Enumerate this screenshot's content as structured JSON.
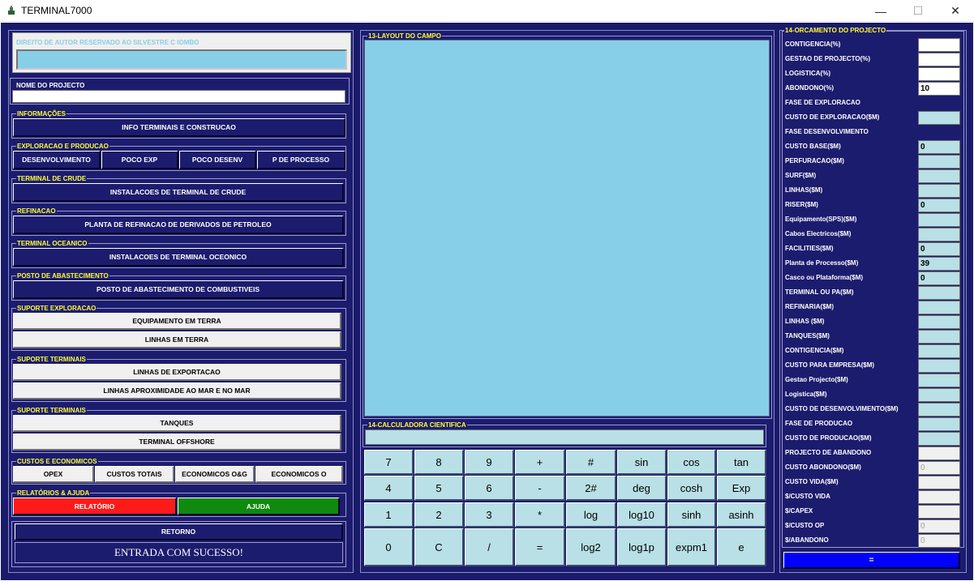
{
  "window": {
    "title": "TERMINAL7000",
    "minimize": "—",
    "maximize": "☐",
    "close": "✕"
  },
  "left": {
    "author": {
      "label": "DIREITO DE AUTOR RESERVADO AO SILVESTRE C IOMBO",
      "value": ""
    },
    "project_name": {
      "label": "NOME DO PROJECTO",
      "value": ""
    },
    "groups": {
      "info": {
        "label": "INFORMAÇÕES",
        "buttons": [
          "INFO TERMINAIS E CONSTRUCAO"
        ]
      },
      "explor": {
        "label": "EXPLORACAO E PRODUCAO",
        "buttons": [
          "DESENVOLVIMENTO",
          "POCO EXP",
          "POCO DESENV",
          "P DE PROCESSO"
        ]
      },
      "crude": {
        "label": "TERMINAL DE CRUDE",
        "buttons": [
          "INSTALACOES DE TERMINAL DE CRUDE"
        ]
      },
      "refin": {
        "label": "REFINACAO",
        "buttons": [
          "PLANTA DE REFINACAO DE DERIVADOS DE PETROLEO"
        ]
      },
      "ocean": {
        "label": "TERMINAL OCEANICO",
        "buttons": [
          "INSTALACOES DE TERMINAL OCEONICO"
        ]
      },
      "posto": {
        "label": "POSTO DE ABASTECIMENTO",
        "buttons": [
          "POSTO DE ABASTECIMENTO DE COMBUSTIVEIS"
        ]
      },
      "sup_exp": {
        "label": "SUPORTE EXPLORACAO",
        "buttons": [
          "EQUIPAMENTO EM TERRA",
          "LINHAS EM TERRA"
        ]
      },
      "sup_term1": {
        "label": "SUPORTE TERMINAIS",
        "buttons": [
          "LINHAS DE EXPORTACAO",
          "LINHAS APROXIMIDADE AO MAR E NO MAR"
        ]
      },
      "sup_term2": {
        "label": "SUPORTE TERMINAIS",
        "buttons": [
          "TANQUES",
          "TERMINAL OFFSHORE"
        ]
      },
      "custos": {
        "label": "CUSTOS E ECONOMICOS",
        "buttons": [
          "OPEX",
          "CUSTOS TOTAIS",
          "ECONOMICOS O&G",
          "ECONOMICOS O"
        ]
      },
      "relat": {
        "label": "RELATÓRIOS & AJUDA",
        "buttons": [
          "RELATÓRIO",
          "AJUDA"
        ]
      }
    },
    "retorno": "RETORNO",
    "status": "ENTRADA COM SUCESSO!",
    "colors": {
      "relatorio": "#ff1a1a",
      "ajuda": "#0f8a0f"
    }
  },
  "layout_campo": {
    "label": "13-LAYOUT DO CAMPO",
    "bg": "#87cfe8"
  },
  "calculator": {
    "label": "14-CALCULADORA CIENTIFICA",
    "display": "",
    "rows": [
      [
        "7",
        "8",
        "9",
        "+",
        "#",
        "sin",
        "cos",
        "tan"
      ],
      [
        "4",
        "5",
        "6",
        "-",
        "2#",
        "deg",
        "cosh",
        "Exp"
      ],
      [
        "1",
        "2",
        "3",
        "*",
        "log",
        "log10",
        "sinh",
        "asinh"
      ],
      [
        "0",
        "C",
        "/",
        "=",
        "log2",
        "log1p",
        "expm1",
        "e"
      ]
    ]
  },
  "budget": {
    "label": "14-ORCAMENTO DO PROJECTO",
    "rows": [
      {
        "label": "CONTIGENCIA(%)",
        "value": "",
        "kind": "white"
      },
      {
        "label": "GESTAO DE PROJECTO(%)",
        "value": "",
        "kind": "white"
      },
      {
        "label": "LOGISTICA(%)",
        "value": "",
        "kind": "white"
      },
      {
        "label": " ABONDONO(%)",
        "value": "10",
        "kind": "white"
      },
      {
        "label": "FASE DE EXPLORACAO",
        "value": "",
        "kind": "none"
      },
      {
        "label": "CUSTO DE EXPLORACAO($M)",
        "value": "",
        "kind": "cyan"
      },
      {
        "label": "FASE DESENVOLVIMENTO",
        "value": "",
        "kind": "none"
      },
      {
        "label": "CUSTO BASE($M)",
        "value": "0",
        "kind": "cyan"
      },
      {
        "label": "PERFURACAO($M)",
        "value": "",
        "kind": "cyan"
      },
      {
        "label": "SURF($M)",
        "value": "",
        "kind": "cyan"
      },
      {
        "label": "LINHAS($M)",
        "value": "",
        "kind": "cyan"
      },
      {
        "label": "RISER($M)",
        "value": "0",
        "kind": "cyan"
      },
      {
        "label": "Equipamento(SPS)($M)",
        "value": "",
        "kind": "cyan"
      },
      {
        "label": "Cabos Electricos($M)",
        "value": "",
        "kind": "cyan"
      },
      {
        "label": "FACILITIES($M)",
        "value": "0",
        "kind": "cyan"
      },
      {
        "label": "Planta de Processo($M)",
        "value": "39",
        "kind": "cyan"
      },
      {
        "label": "Casco ou Plataforma($M)",
        "value": "0",
        "kind": "cyan"
      },
      {
        "label": "TERMINAL OU PA($M)",
        "value": "",
        "kind": "cyan"
      },
      {
        "label": "REFINARIA($M)",
        "value": "",
        "kind": "cyan"
      },
      {
        "label": "LINHAS ($M)",
        "value": "",
        "kind": "cyan"
      },
      {
        "label": "TANQUES($M)",
        "value": "",
        "kind": "cyan"
      },
      {
        "label": "CONTIGENCIA($M)",
        "value": "",
        "kind": "cyan"
      },
      {
        "label": "CUSTO PARA EMPRESA($M)",
        "value": "",
        "kind": "cyan"
      },
      {
        "label": "Gestao Projecto($M)",
        "value": "",
        "kind": "cyan"
      },
      {
        "label": "Logistica($M)",
        "value": "",
        "kind": "cyan"
      },
      {
        "label": "CUSTO DE DESENVOLVIMENTO($M)",
        "value": "",
        "kind": "cyan"
      },
      {
        "label": "FASE DE PRODUCAO",
        "value": "",
        "kind": "cyan"
      },
      {
        "label": "CUSTO DE PRODUCAO($M)",
        "value": "",
        "kind": "cyan"
      },
      {
        "label": "PROJECTO DE ABANDONO",
        "value": "",
        "kind": "grey"
      },
      {
        "label": "CUSTO ABONDONO($M)",
        "value": "0",
        "kind": "grey"
      },
      {
        "label": "CUSTO VIDA($M)",
        "value": "",
        "kind": "grey"
      },
      {
        "label": "$/CUSTO VIDA",
        "value": "",
        "kind": "grey"
      },
      {
        "label": "$/CAPEX",
        "value": "",
        "kind": "grey"
      },
      {
        "label": "$/CUSTO OP",
        "value": "0",
        "kind": "grey"
      },
      {
        "label": "$/ABANDONO",
        "value": "0",
        "kind": "grey"
      }
    ],
    "equals_button": "=",
    "colors": {
      "white": "#ffffff",
      "cyan": "#b8e0e6",
      "grey": "#f0f0f0",
      "equals": "#0000ff"
    }
  }
}
